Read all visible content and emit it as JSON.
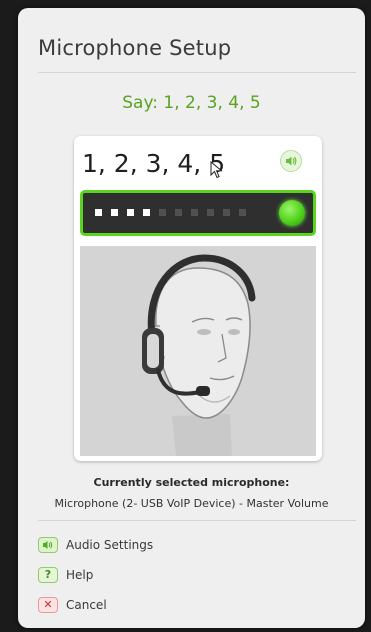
{
  "dialog": {
    "title": "Microphone Setup",
    "prompt": "Say: 1, 2, 3, 4, 5"
  },
  "card": {
    "spoken_text": "1, 2, 3, 4, 5",
    "speaker_icon": "speaker-icon",
    "level_meter": {
      "total_segments": 10,
      "lit_segments": 4,
      "indicator_color": "#5bd41d"
    },
    "illustration": "headset-head-illustration"
  },
  "microphone": {
    "label": "Currently selected microphone:",
    "device": "Microphone (2- USB VoIP Device) - Master Volume"
  },
  "menu": {
    "items": [
      {
        "label": "Audio Settings",
        "icon": "speaker-icon"
      },
      {
        "label": "Help",
        "icon": "question-icon"
      },
      {
        "label": "Cancel",
        "icon": "close-icon"
      }
    ]
  },
  "colors": {
    "accent": "#58a31f",
    "meter_border": "#5bd41d",
    "background": "#efefef"
  }
}
